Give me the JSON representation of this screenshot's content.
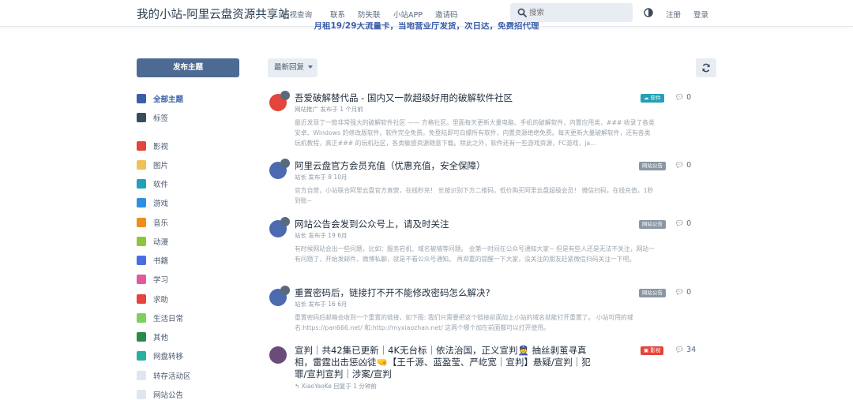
{
  "header": {
    "site_title": "我的小站-阿里云盘资源共享站",
    "nav": [
      "影视查询",
      "联系",
      "防失联",
      "小站APP",
      "邀请码"
    ],
    "search_placeholder": "搜索",
    "register": "注册",
    "login": "登录"
  },
  "banner": "月租19/29大流量卡，当地营业厅发货，次日达，免费招代理",
  "sidebar": {
    "post_button": "发布主题",
    "items": [
      {
        "label": "全部主题",
        "icon": "chat-icon",
        "color": "#3b5ea8"
      },
      {
        "label": "标签",
        "icon": "grid-icon",
        "color": "#3b4a5c"
      },
      {
        "label": "影视",
        "icon": "video-icon",
        "color": "#e3443c"
      },
      {
        "label": "图片",
        "icon": "image-icon",
        "color": "#f0c05a"
      },
      {
        "label": "软件",
        "icon": "cloud-icon",
        "color": "#22a0b8"
      },
      {
        "label": "游戏",
        "icon": "check-icon",
        "color": "#2f8ee0"
      },
      {
        "label": "音乐",
        "icon": "music-icon",
        "color": "#f08c1c"
      },
      {
        "label": "动漫",
        "icon": "android-icon",
        "color": "#8cc63f"
      },
      {
        "label": "书籍",
        "icon": "book-icon",
        "color": "#4a6ee0"
      },
      {
        "label": "学习",
        "icon": "graduation-icon",
        "color": "#e25a9a"
      },
      {
        "label": "求助",
        "icon": "question-icon",
        "color": "#e3443c"
      },
      {
        "label": "生活日常",
        "icon": "calendar-icon",
        "color": "#7ed05c"
      },
      {
        "label": "其他",
        "icon": "feather-icon",
        "color": "#2a8a4a"
      },
      {
        "label": "网盘转移",
        "icon": "exchange-icon",
        "color": "#2ab0a0"
      },
      {
        "label": "转存活动区",
        "icon": "tag-icon",
        "color": "#e0e6ed"
      },
      {
        "label": "网站公告",
        "icon": "tag-icon",
        "color": "#e0e6ed"
      }
    ]
  },
  "toolbar": {
    "sort_label": "最新回复"
  },
  "discussions": [
    {
      "title": "吾爱破解替代品 - 国内又一款超级好用的破解软件社区",
      "meta": "网站推广 发布于 1 个月前",
      "excerpt": "最近发现了一款非常强大的破解软件社区 —— 方格社区。里面每天更新大量电脑、手机的破解软件，内置应用类，### 收录了各类安卓、Windows 的修改版软件。软件完全免费，免登陆即可白嫖所有软件，内置资源绝绝免费。每天更新大量破解软件，还有各类玩机教程，真正### 的玩机社区，各类敏感资源随意下载。除此之外，软件还有一些游戏资源，FC游戏，ja...",
      "tag": "软件",
      "tag_color": "#22a0b8",
      "replies": "0",
      "avatar_color": "#e3443c"
    },
    {
      "title": "阿里云盘官方会员充值（优惠充值，安全保障）",
      "meta": "站长 发布于 8 10月",
      "excerpt": "官方自营，小站联合阿里云盘官方直营，在线秒充！ 长按识别下方二维码，低价购买阿里云盘超级会员！ 微信扫码，在线充值，1秒到账~",
      "tag": "网站公告",
      "tag_color": "#8a96a3",
      "replies": "0",
      "avatar_color": "#4c6ab0"
    },
    {
      "title": "网站公告会发到公众号上，请及时关注",
      "meta": "站长 发布于 19 6月",
      "excerpt": "有时候网站会出一些问题，比如：服务宕机、域名被墙等问题。 会第一时间在公众号通知大家~ 但是有些人还是无法不关注，网站一有问题了，开始发邮件、微博私聊，就是不看公众号通知。 再郑重的提醒一下大家，没关注的朋友赶紧微信扫码关注一下吧。",
      "tag": "网站公告",
      "tag_color": "#8a96a3",
      "replies": "0",
      "avatar_color": "#4c6ab0"
    },
    {
      "title": "重置密码后，链接打不开不能修改密码怎么解决?",
      "meta": "站长 发布于 16 6月",
      "excerpt": "重置密码后邮箱会收到一个重置的链接，如下图: 我们只需要把这个链接前面加上小站的域名就能打开重置了。 小站可用的域名:https://pan666.net/ 和:http://myxiaozhan.net/ 这两个哪个加在前面都可以打开使用。",
      "tag": "网站公告",
      "tag_color": "#8a96a3",
      "replies": "0",
      "avatar_color": "#4c6ab0"
    },
    {
      "title_line1": "宣判｜共42集已更新｜4K无台标｜依法治国，正义宣判👮 抽丝剥茧寻真",
      "title_line2": "相，雷霆出击惩凶徒🤜【王千源、蓝盈莹、严屹宽｜宣判】悬疑/宣判｜犯",
      "title_line3": "罪/宣判宣判｜涉案/宣判",
      "meta": "↰ XiaoYaoKe 回复于 1 分钟前",
      "tag": "影视",
      "tag_color": "#e3443c",
      "replies": "34",
      "avatar_color": "#6a4c7a"
    }
  ],
  "colors": {
    "accent": "#4c6a92",
    "link": "#3b5ea8"
  }
}
